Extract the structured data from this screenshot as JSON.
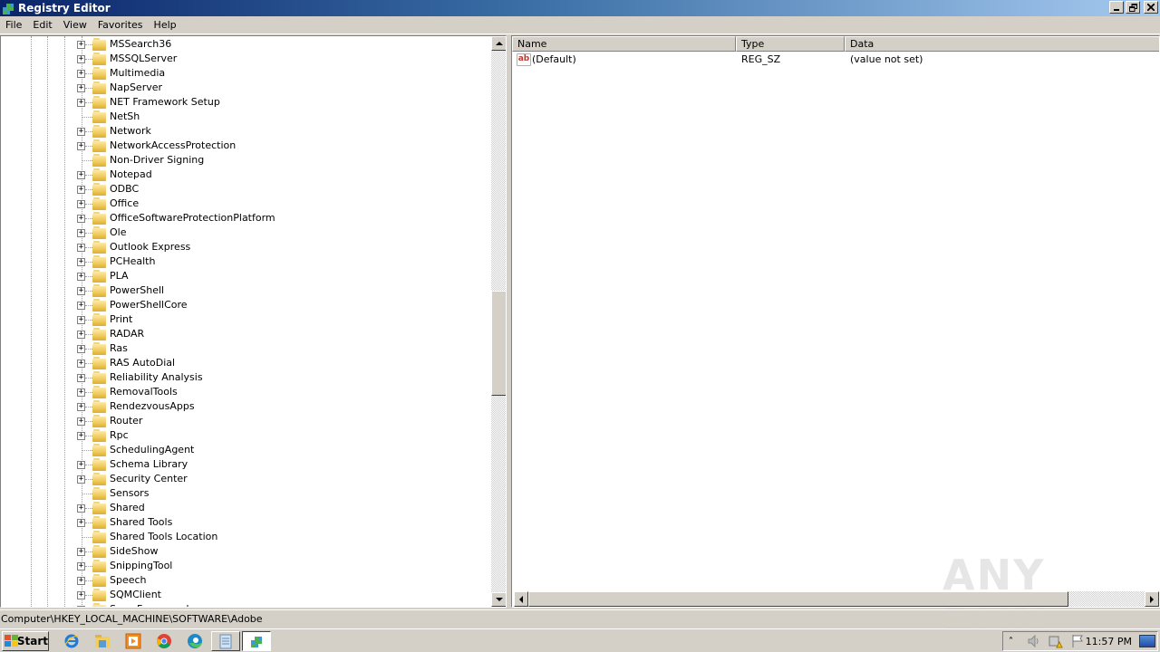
{
  "window": {
    "title": "Registry Editor",
    "controls": [
      "minimize",
      "restore",
      "close"
    ]
  },
  "menu": [
    "File",
    "Edit",
    "View",
    "Favorites",
    "Help"
  ],
  "tree": {
    "items": [
      {
        "label": "MSSearch36",
        "expandable": true
      },
      {
        "label": "MSSQLServer",
        "expandable": true
      },
      {
        "label": "Multimedia",
        "expandable": true
      },
      {
        "label": "NapServer",
        "expandable": true
      },
      {
        "label": "NET Framework Setup",
        "expandable": true
      },
      {
        "label": "NetSh",
        "expandable": false
      },
      {
        "label": "Network",
        "expandable": true
      },
      {
        "label": "NetworkAccessProtection",
        "expandable": true
      },
      {
        "label": "Non-Driver Signing",
        "expandable": false
      },
      {
        "label": "Notepad",
        "expandable": true
      },
      {
        "label": "ODBC",
        "expandable": true
      },
      {
        "label": "Office",
        "expandable": true
      },
      {
        "label": "OfficeSoftwareProtectionPlatform",
        "expandable": true
      },
      {
        "label": "Ole",
        "expandable": true
      },
      {
        "label": "Outlook Express",
        "expandable": true
      },
      {
        "label": "PCHealth",
        "expandable": true
      },
      {
        "label": "PLA",
        "expandable": true
      },
      {
        "label": "PowerShell",
        "expandable": true
      },
      {
        "label": "PowerShellCore",
        "expandable": true
      },
      {
        "label": "Print",
        "expandable": true
      },
      {
        "label": "RADAR",
        "expandable": true
      },
      {
        "label": "Ras",
        "expandable": true
      },
      {
        "label": "RAS AutoDial",
        "expandable": true
      },
      {
        "label": "Reliability Analysis",
        "expandable": true
      },
      {
        "label": "RemovalTools",
        "expandable": true
      },
      {
        "label": "RendezvousApps",
        "expandable": true
      },
      {
        "label": "Router",
        "expandable": true
      },
      {
        "label": "Rpc",
        "expandable": true
      },
      {
        "label": "SchedulingAgent",
        "expandable": false
      },
      {
        "label": "Schema Library",
        "expandable": true
      },
      {
        "label": "Security Center",
        "expandable": true
      },
      {
        "label": "Sensors",
        "expandable": false
      },
      {
        "label": "Shared",
        "expandable": true
      },
      {
        "label": "Shared Tools",
        "expandable": true
      },
      {
        "label": "Shared Tools Location",
        "expandable": false
      },
      {
        "label": "SideShow",
        "expandable": true
      },
      {
        "label": "SnippingTool",
        "expandable": true
      },
      {
        "label": "Speech",
        "expandable": true
      },
      {
        "label": "SQMClient",
        "expandable": true
      },
      {
        "label": "Sync Framework",
        "expandable": true
      }
    ],
    "expander_glyph": "+",
    "scroll_position": 0.55
  },
  "values": {
    "columns": [
      "Name",
      "Type",
      "Data"
    ],
    "rows": [
      {
        "icon": "string-value-icon",
        "icon_text": "ab",
        "name": "(Default)",
        "type": "REG_SZ",
        "data": "(value not set)"
      }
    ]
  },
  "statusbar": {
    "path": "Computer\\HKEY_LOCAL_MACHINE\\SOFTWARE\\Adobe"
  },
  "taskbar": {
    "start_label": "Start",
    "pinned": [
      "internet-explorer-icon",
      "file-explorer-icon",
      "media-player-icon",
      "chrome-icon",
      "edge-icon",
      "notepad-icon"
    ],
    "active_task": "registry-editor-icon",
    "tray": [
      "show-hidden-icons",
      "volume-icon",
      "network-warning-icon",
      "action-center-flag-icon"
    ],
    "clock": "11:57 PM"
  },
  "watermark": "ANY RUN",
  "colors": {
    "title_start": "#0a246a",
    "title_end": "#a6caf0",
    "chrome": "#d4d0c8",
    "folder": "#f1cc5f",
    "ab_icon": "#c0392b"
  }
}
